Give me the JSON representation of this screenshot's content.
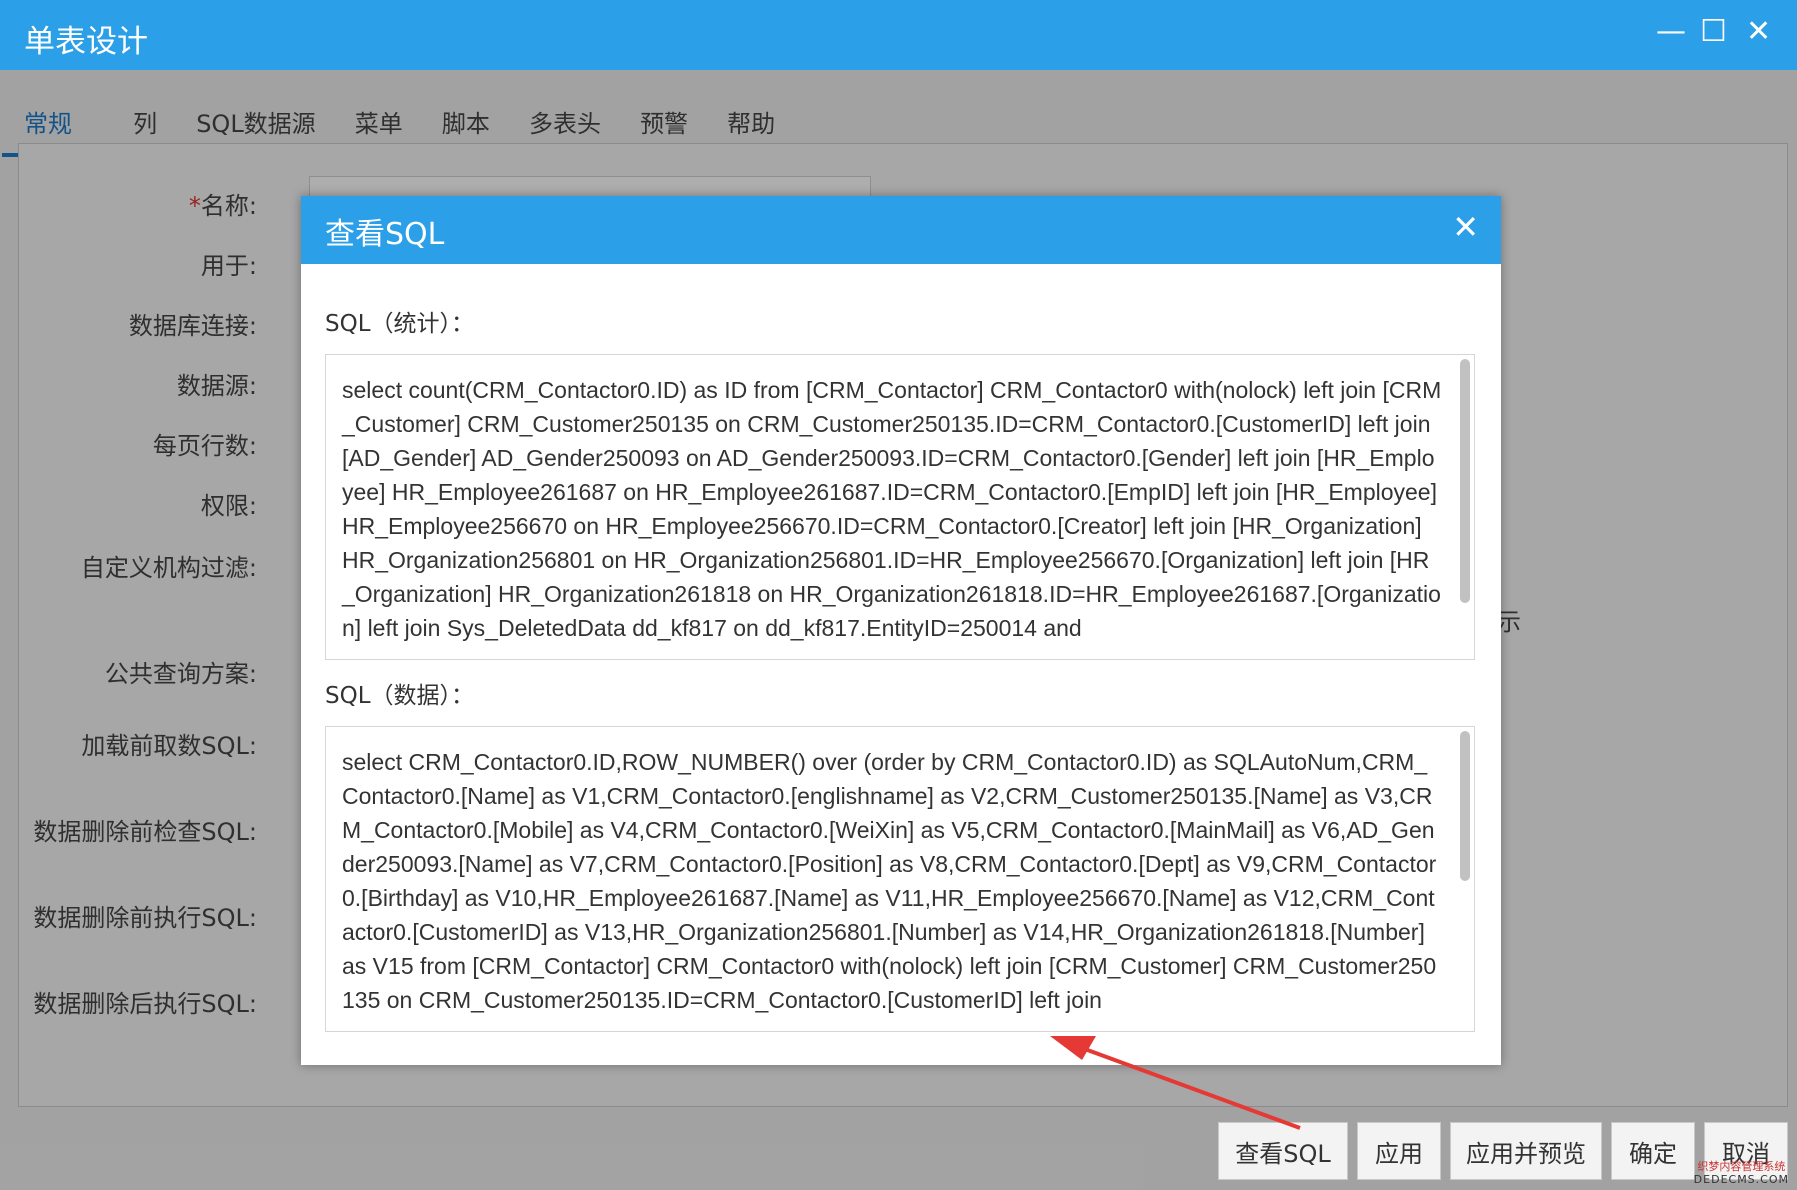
{
  "window": {
    "title": "单表设计",
    "minimize_icon": "minimize-icon",
    "maximize_icon": "maximize-icon",
    "close_icon": "close-icon",
    "minimize_glyph": "—",
    "maximize_glyph": "☐",
    "close_glyph": "✕"
  },
  "tabs": [
    "常规",
    "列",
    "SQL数据源",
    "菜单",
    "脚本",
    "多表头",
    "预警",
    "帮助"
  ],
  "form": {
    "labels": {
      "name_req": "*",
      "name": "名称:",
      "used_for": "用于:",
      "db_conn": "数据库连接:",
      "datasource": "数据源:",
      "page_rows": "每页行数:",
      "permission": "权限:",
      "org_filter": "自定义机构过滤:",
      "public_query": "公共查询方案:",
      "preload_sql": "加载前取数SQL:",
      "pre_delete_check_sql": "数据删除前检查SQL:",
      "pre_delete_exec_sql": "数据删除前执行SQL:",
      "post_delete_exec_sql": "数据删除后执行SQL:"
    },
    "side_text": "示"
  },
  "modal": {
    "title": "查看SQL",
    "close_glyph": "✕",
    "stat_label": "SQL（统计）：",
    "stat_sql": "select count(CRM_Contactor0.ID) as ID from [CRM_Contactor] CRM_Contactor0 with(nolock) left join [CRM_Customer] CRM_Customer250135 on CRM_Customer250135.ID=CRM_Contactor0.[CustomerID] left join [AD_Gender] AD_Gender250093 on AD_Gender250093.ID=CRM_Contactor0.[Gender] left join [HR_Employee] HR_Employee261687 on HR_Employee261687.ID=CRM_Contactor0.[EmpID] left join [HR_Employee] HR_Employee256670 on HR_Employee256670.ID=CRM_Contactor0.[Creator] left join [HR_Organization] HR_Organization256801 on HR_Organization256801.ID=HR_Employee256670.[Organization] left join [HR_Organization] HR_Organization261818 on HR_Organization261818.ID=HR_Employee261687.[Organization] left join Sys_DeletedData dd_kf817 on dd_kf817.EntityID=250014 and",
    "data_label": "SQL（数据）：",
    "data_sql": "select CRM_Contactor0.ID,ROW_NUMBER() over (order by CRM_Contactor0.ID) as SQLAutoNum,CRM_Contactor0.[Name] as V1,CRM_Contactor0.[englishname] as V2,CRM_Customer250135.[Name] as V3,CRM_Contactor0.[Mobile] as V4,CRM_Contactor0.[WeiXin] as V5,CRM_Contactor0.[MainMail] as V6,AD_Gender250093.[Name] as V7,CRM_Contactor0.[Position] as V8,CRM_Contactor0.[Dept] as V9,CRM_Contactor0.[Birthday] as V10,HR_Employee261687.[Name] as V11,HR_Employee256670.[Name] as V12,CRM_Contactor0.[CustomerID] as V13,HR_Organization256801.[Number] as V14,HR_Organization261818.[Number] as V15 from [CRM_Contactor] CRM_Contactor0 with(nolock) left join [CRM_Customer] CRM_Customer250135 on CRM_Customer250135.ID=CRM_Contactor0.[CustomerID] left join"
  },
  "footer": {
    "view_sql": "查看SQL",
    "apply": "应用",
    "apply_preview": "应用并预览",
    "ok": "确定",
    "cancel": "取消"
  },
  "watermark": {
    "cn": "织梦内容管理系统",
    "en": "DEDECMS.COM"
  },
  "colors": {
    "title_bar": "#2b9fe8",
    "active_tab": "#1e78c4",
    "annotation_arrow": "#e53935"
  }
}
